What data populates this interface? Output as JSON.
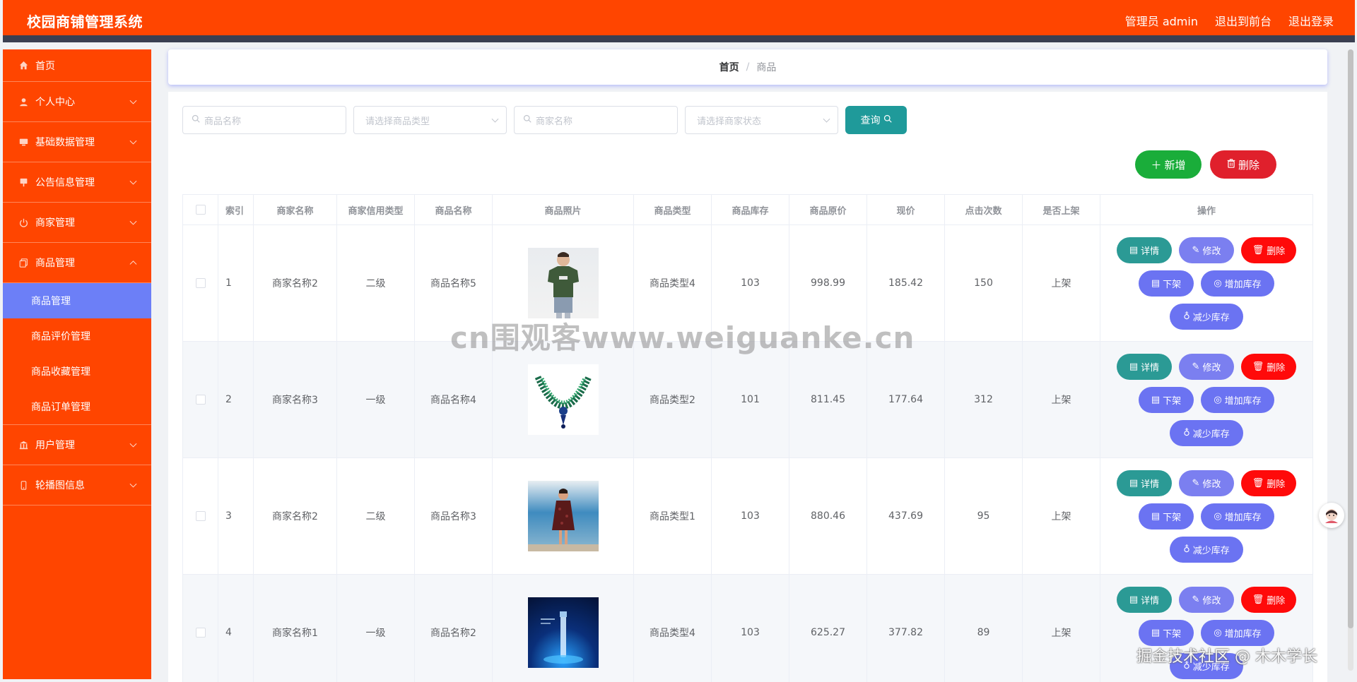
{
  "header": {
    "title": "校园商铺管理系统",
    "admin": "管理员 admin",
    "to_front": "退出到前台",
    "logout": "退出登录"
  },
  "sidebar": {
    "items": [
      {
        "label": "首页",
        "icon": "home-icon"
      },
      {
        "label": "个人中心",
        "icon": "user-icon"
      },
      {
        "label": "基础数据管理",
        "icon": "monitor-icon"
      },
      {
        "label": "公告信息管理",
        "icon": "board-icon"
      },
      {
        "label": "商家管理",
        "icon": "power-icon"
      },
      {
        "label": "商品管理",
        "icon": "copy-icon"
      },
      {
        "label": "用户管理",
        "icon": "bank-icon"
      },
      {
        "label": "轮播图信息",
        "icon": "phone-icon"
      }
    ],
    "sub_items": [
      "商品管理",
      "商品评价管理",
      "商品收藏管理",
      "商品订单管理"
    ]
  },
  "breadcrumb": {
    "home": "首页",
    "sep": "/",
    "current": "商品"
  },
  "search": {
    "goods_name_placeholder": "商品名称",
    "goods_type_placeholder": "请选择商品类型",
    "shop_name_placeholder": "商家名称",
    "shop_status_placeholder": "请选择商家状态",
    "query_label": "查询"
  },
  "actions": {
    "add_label": "新增",
    "delete_label": "删除"
  },
  "table": {
    "headers": [
      "索引",
      "商家名称",
      "商家信用类型",
      "商品名称",
      "商品照片",
      "商品类型",
      "商品库存",
      "商品原价",
      "现价",
      "点击次数",
      "是否上架",
      "操作"
    ],
    "rows": [
      {
        "index": "1",
        "shop": "商家名称2",
        "credit": "二级",
        "name": "商品名称5",
        "type": "商品类型4",
        "stock": "103",
        "price": "998.99",
        "now": "185.42",
        "clicks": "150",
        "status": "上架"
      },
      {
        "index": "2",
        "shop": "商家名称3",
        "credit": "一级",
        "name": "商品名称4",
        "type": "商品类型2",
        "stock": "101",
        "price": "811.45",
        "now": "177.64",
        "clicks": "312",
        "status": "上架"
      },
      {
        "index": "3",
        "shop": "商家名称2",
        "credit": "二级",
        "name": "商品名称3",
        "type": "商品类型1",
        "stock": "103",
        "price": "880.46",
        "now": "437.69",
        "clicks": "95",
        "status": "上架"
      },
      {
        "index": "4",
        "shop": "商家名称1",
        "credit": "一级",
        "name": "商品名称2",
        "type": "商品类型4",
        "stock": "103",
        "price": "625.27",
        "now": "377.82",
        "clicks": "89",
        "status": "上架"
      }
    ],
    "ops": {
      "detail": "详情",
      "edit": "修改",
      "delete": "删除",
      "offshelf": "下架",
      "add_stock": "增加库存",
      "reduce_stock": "减少库存"
    }
  },
  "watermark": "cn围观客www.weiguanke.cn",
  "watermark2": "掘金技术社区 @ 木木学长",
  "colors": {
    "primary": "#ff4500",
    "active": "#6c7ff7",
    "teal": "#2b9a95",
    "green": "#1aad3a",
    "red": "#e0202c"
  }
}
